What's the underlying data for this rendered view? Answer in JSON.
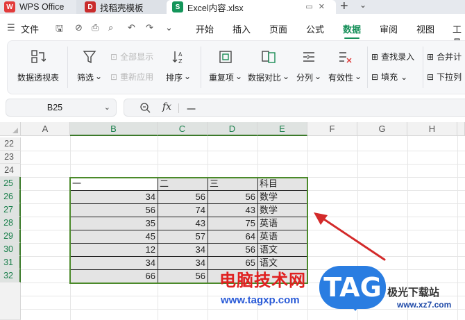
{
  "titlebar": {
    "tabs": [
      {
        "label": "WPS Office",
        "logo": "W"
      },
      {
        "label": "找稻壳模板",
        "logo": "D"
      },
      {
        "label": "Excel内容.xlsx",
        "logo": "S"
      }
    ],
    "new_tab": "+",
    "dropdown": "⌄"
  },
  "menubar": {
    "file": "文件",
    "tabs": [
      "开始",
      "插入",
      "页面",
      "公式",
      "数据",
      "审阅",
      "视图",
      "工具"
    ],
    "active_tab": "数据",
    "accent_color": "#17905a"
  },
  "ribbon": {
    "pivot": "数据透视表",
    "filter": "筛选",
    "show_all": "全部显示",
    "reapply": "重新应用",
    "sort": "排序",
    "duplicates": "重复项",
    "compare": "数据对比",
    "split": "分列",
    "validity": "有效性",
    "find_entry": "查找录入",
    "fill": "填充",
    "merge": "合并计",
    "dropdown_list": "下拉列"
  },
  "namebox": {
    "value": "B25"
  },
  "formula": {
    "fx": "fx",
    "value": "一"
  },
  "grid": {
    "columns": [
      "A",
      "B",
      "C",
      "D",
      "E",
      "F",
      "G",
      "H"
    ],
    "selected_columns": [
      "B",
      "C",
      "D",
      "E"
    ],
    "rows": [
      "22",
      "23",
      "24",
      "25",
      "26",
      "27",
      "28",
      "29",
      "30",
      "31",
      "32"
    ],
    "selected_rows": [
      "25",
      "26",
      "27",
      "28",
      "29",
      "30",
      "31",
      "32"
    ],
    "table": {
      "header": [
        "一",
        "二",
        "三",
        "科目"
      ],
      "body": [
        [
          "34",
          "56",
          "56",
          "数学"
        ],
        [
          "56",
          "74",
          "43",
          "数学"
        ],
        [
          "35",
          "43",
          "75",
          "英语"
        ],
        [
          "45",
          "57",
          "64",
          "英语"
        ],
        [
          "12",
          "34",
          "56",
          "语文"
        ],
        [
          "34",
          "34",
          "65",
          "语文"
        ],
        [
          "66",
          "56",
          "",
          ""
        ]
      ]
    },
    "selection_color": "#4b8a2a"
  },
  "watermark": {
    "site_name": "电脑技术网",
    "url": "www.tagxp.com",
    "tag": "TAG",
    "site2": "极光下载站",
    "url2": "www.xz7.com"
  }
}
